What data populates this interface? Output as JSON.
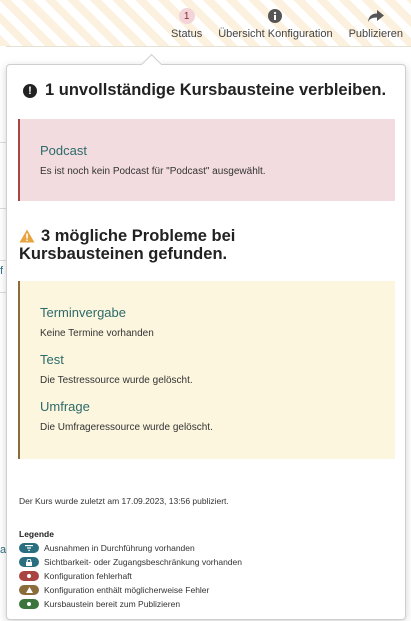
{
  "toolbar": {
    "status": {
      "label": "Status",
      "badge": "1"
    },
    "overview": {
      "label": "Übersicht Konfiguration"
    },
    "publish": {
      "label": "Publizieren"
    }
  },
  "errors": {
    "heading": "1 unvollständige Kursbausteine verbleiben.",
    "items": [
      {
        "title": "Podcast",
        "description": "Es ist noch kein Podcast für \"Podcast\" ausgewählt."
      }
    ]
  },
  "warnings": {
    "heading": "3 mögliche Probleme bei Kursbausteinen gefunden.",
    "items": [
      {
        "title": "Terminvergabe",
        "description": "Keine Termine vorhanden"
      },
      {
        "title": "Test",
        "description": "Die Testressource wurde gelöscht."
      },
      {
        "title": "Umfrage",
        "description": "Die Umfrageressource wurde gelöscht."
      }
    ]
  },
  "published_note": "Der Kurs wurde zuletzt am 17.09.2023, 13:56 publiziert.",
  "legend": {
    "title": "Legende",
    "items": [
      {
        "label": "Ausnahmen in Durchführung vorhanden",
        "color": "#2a6f80",
        "icon": "filter-icon"
      },
      {
        "label": "Sichtbarkeit- oder Zugangsbeschränkung vorhanden",
        "color": "#2a6f80",
        "icon": "lock-icon"
      },
      {
        "label": "Konfiguration fehlerhaft",
        "color": "#a94442",
        "icon": "error-icon"
      },
      {
        "label": "Konfiguration enthält möglicherweise Fehler",
        "color": "#8a6d3b",
        "icon": "warning-icon"
      },
      {
        "label": "Kursbaustein bereit zum Publizieren",
        "color": "#3c763d",
        "icon": "ready-icon"
      }
    ]
  },
  "background": {
    "letters": [
      "f",
      "a"
    ]
  }
}
